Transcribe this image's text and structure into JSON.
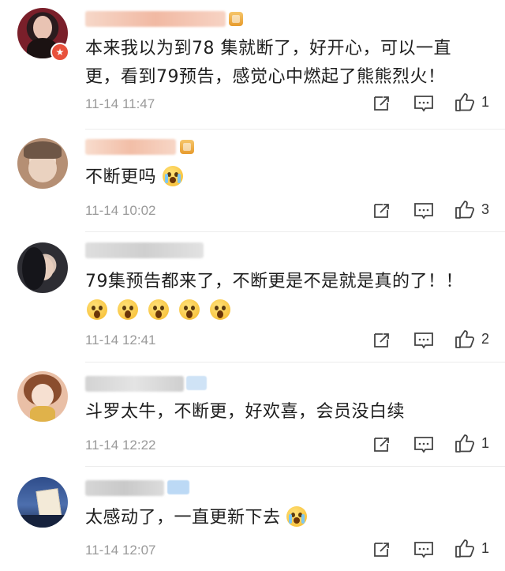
{
  "comments": [
    {
      "text": "本来我以为到78 集就断了，好开心，可以一直更，看到79预告，感觉心中燃起了熊熊烈火！",
      "time": "11-14 11:47",
      "likes": "1",
      "avatar_color": "#7a1f2a",
      "verified_icon": "v-badge-icon"
    },
    {
      "text": "不断更吗",
      "emoji": [
        "crying-face-emoji"
      ],
      "time": "11-14 10:02",
      "likes": "3",
      "avatar_color": "#c9b29a"
    },
    {
      "text": "79集预告都来了，不断更是不是就是真的了！！",
      "emoji": [
        "screaming-face-emoji",
        "screaming-face-emoji",
        "screaming-face-emoji",
        "screaming-face-emoji",
        "screaming-face-emoji"
      ],
      "time": "11-14 12:41",
      "likes": "2",
      "avatar_color": "#3a3a40"
    },
    {
      "text": "斗罗太牛，不断更，好欢喜，会员没白续",
      "time": "11-14 12:22",
      "likes": "1",
      "avatar_color": "#e8c7b0"
    },
    {
      "text": "太感动了，一直更新下去",
      "emoji": [
        "crying-face-emoji"
      ],
      "time": "11-14 12:07",
      "likes": "1",
      "avatar_color": "#2f4d8a"
    }
  ],
  "colors": {
    "text": "#1e1e1e",
    "meta": "#9a9a9a",
    "name_blur": "#f4c9b5",
    "name_blur_gray": "#d8d8d8",
    "vip_gold": "#e79b2d",
    "divider": "#ececec"
  }
}
